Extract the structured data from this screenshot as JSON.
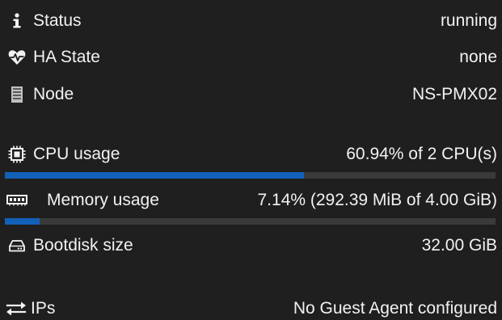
{
  "summary": {
    "status": {
      "icon": "info-icon",
      "label": "Status",
      "value": "running"
    },
    "ha_state": {
      "icon": "heartbeat-icon",
      "label": "HA State",
      "value": "none"
    },
    "node": {
      "icon": "server-icon",
      "label": "Node",
      "value": "NS-PMX02"
    },
    "cpu": {
      "icon": "cpu-icon",
      "label": "CPU usage",
      "value": "60.94% of 2 CPU(s)",
      "fraction": 0.6094
    },
    "memory": {
      "icon": "memory-icon",
      "label": "Memory usage",
      "value": "7.14% (292.39 MiB of 4.00 GiB)",
      "fraction": 0.0714
    },
    "bootdisk": {
      "icon": "hdd-icon",
      "label": "Bootdisk size",
      "value": "32.00 GiB"
    },
    "ips": {
      "icon": "exchange-icon",
      "label": "IPs",
      "value": "No Guest Agent configured"
    }
  },
  "colors": {
    "background": "#1f1f1f",
    "text": "#f2f2f2",
    "bar_track": "#3a3a3a",
    "bar_fill": "#1260b8"
  }
}
